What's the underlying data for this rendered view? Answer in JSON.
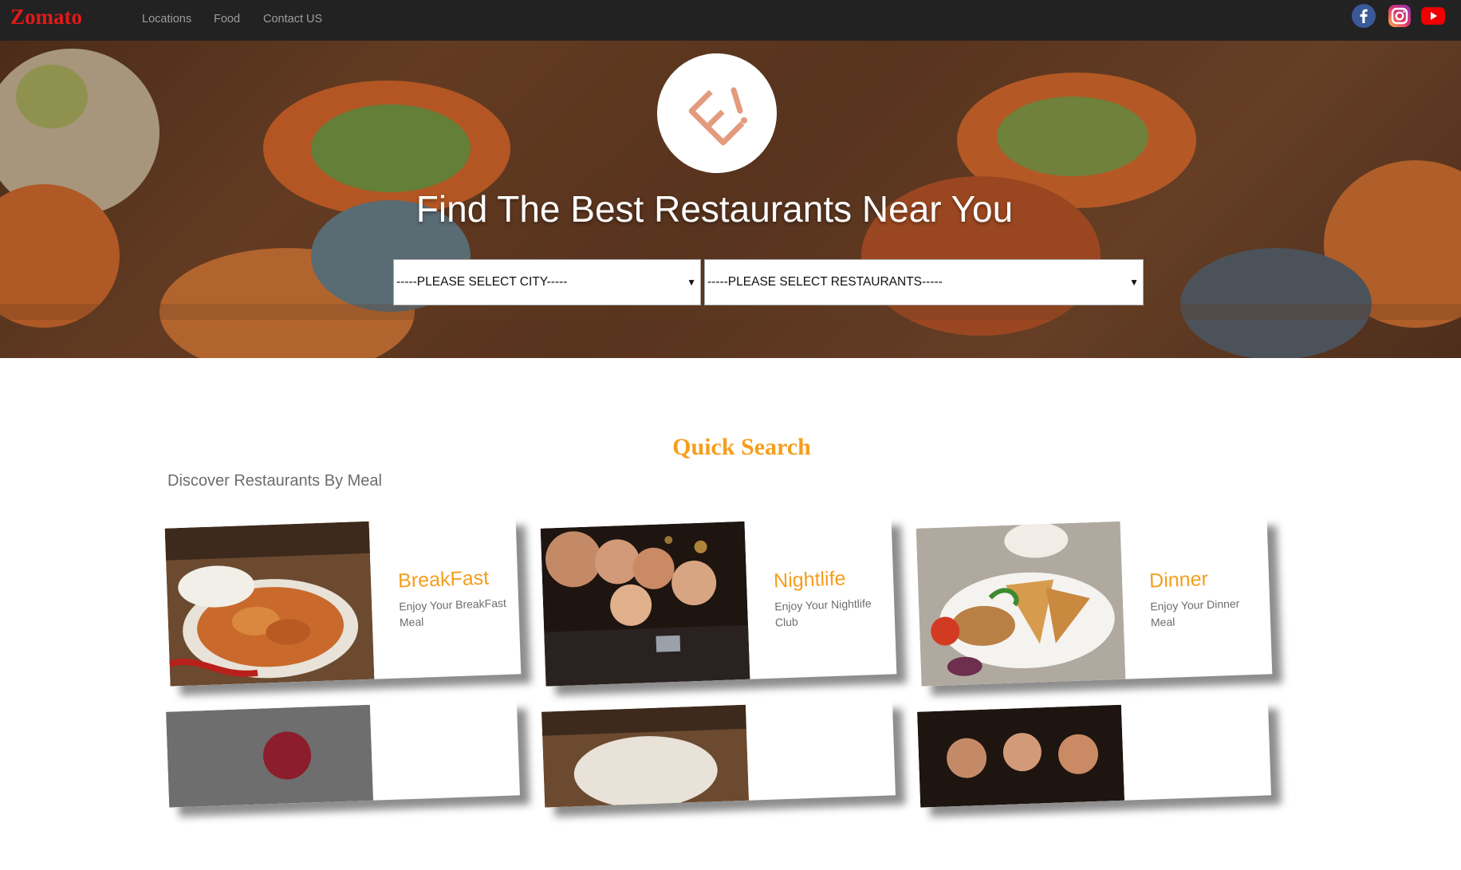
{
  "navbar": {
    "brand": "Zomato",
    "links": [
      "Locations",
      "Food",
      "Contact US"
    ],
    "social_icons": [
      "facebook-icon",
      "instagram-icon",
      "youtube-icon"
    ]
  },
  "hero": {
    "title": "Find The Best Restaurants Near You",
    "city_select": "-----PLEASE SELECT CITY-----",
    "restaurant_select": "-----PLEASE SELECT RESTAURANTS-----"
  },
  "quick_search": {
    "title": "Quick Search",
    "subtitle": "Discover Restaurants By Meal",
    "cards": [
      {
        "title": "BreakFast",
        "desc": "Enjoy Your BreakFast Meal"
      },
      {
        "title": "Nightlife",
        "desc": "Enjoy Your Nightlife Club"
      },
      {
        "title": "Dinner",
        "desc": "Enjoy Your Dinner Meal"
      }
    ]
  },
  "colors": {
    "brand": "#e01a1a",
    "accent": "#f59e1c",
    "navbar": "#222222"
  }
}
